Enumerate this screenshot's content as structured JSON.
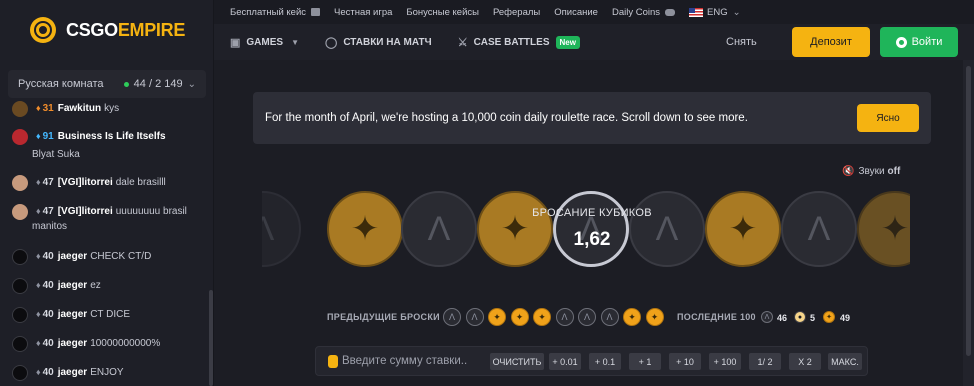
{
  "brand": {
    "word1": "CSGO",
    "word2": "EMPIRE"
  },
  "colors": {
    "accent": "#f5b311",
    "login": "#1fb55a",
    "online": "#2ecc5a"
  },
  "sidebar": {
    "room_label": "Русская комната",
    "online_count": "44 / 2 149",
    "messages": [
      {
        "avatar": "gold",
        "level": "31",
        "level_style": "orange",
        "user": "Fawkitun",
        "text": "kys"
      },
      {
        "avatar": "umbrella",
        "level": "91",
        "level_style": "blue",
        "user": "Business Is Life Itselfs",
        "text": "Blyat Suka"
      },
      {
        "avatar": "face",
        "level": "47",
        "level_style": "normal",
        "user": "[VGI]litorrei",
        "text": "dale brasilll"
      },
      {
        "avatar": "face",
        "level": "47",
        "level_style": "normal",
        "user": "[VGI]litorrei",
        "text": "uuuuuuuu brasil",
        "text2": "manitos"
      },
      {
        "avatar": "dark",
        "level": "40",
        "level_style": "normal",
        "user": "jaeger",
        "text": "CHECK CT/D"
      },
      {
        "avatar": "dark",
        "level": "40",
        "level_style": "normal",
        "user": "jaeger",
        "text": "ez"
      },
      {
        "avatar": "dark",
        "level": "40",
        "level_style": "normal",
        "user": "jaeger",
        "text": "CT DICE"
      },
      {
        "avatar": "dark",
        "level": "40",
        "level_style": "normal",
        "user": "jaeger",
        "text": "10000000000%"
      },
      {
        "avatar": "dark",
        "level": "40",
        "level_style": "normal",
        "user": "jaeger",
        "text": "ENJOY"
      }
    ]
  },
  "topbar": {
    "links": [
      "Бесплатный кейс",
      "Честная игра",
      "Бонусные кейсы",
      "Рефералы",
      "Описание",
      "Daily Coins"
    ],
    "language": "ENG"
  },
  "nav": {
    "games": "GAMES",
    "bets": "СТАВКИ НА МАТЧ",
    "case_battles": "CASE BATTLES",
    "new_badge": "New",
    "withdraw": "Снять",
    "deposit": "Депозит",
    "login": "Войти"
  },
  "banner": {
    "text": "For the month of April, we're hosting a 10,000 coin daily roulette race. Scroll down to see more.",
    "button": "Ясно"
  },
  "sound": {
    "label": "Звуки",
    "state": "off"
  },
  "roulette": {
    "title": "БРОСАНИЕ КУБИКОВ",
    "value": "1,62",
    "reel": [
      "ct",
      "t",
      "ct",
      "t",
      "ct",
      "ct",
      "t",
      "ct",
      "t"
    ],
    "previous_label": "ПРЕДЫДУЩИЕ БРОСКИ",
    "previous": [
      "ct",
      "ct",
      "t",
      "t",
      "t",
      "ct",
      "ct",
      "ct",
      "t",
      "t"
    ],
    "last100_label": "ПОСЛЕДНИЕ 100",
    "last100": {
      "ct": "46",
      "bonus": "5",
      "t": "49"
    }
  },
  "bet": {
    "placeholder": "Введите сумму ставки..",
    "buttons": [
      "ОЧИСТИТЬ",
      "+ 0.01",
      "+ 0.1",
      "+ 1",
      "+ 10",
      "+ 100",
      "1/ 2",
      "X 2",
      "МАКС."
    ]
  }
}
